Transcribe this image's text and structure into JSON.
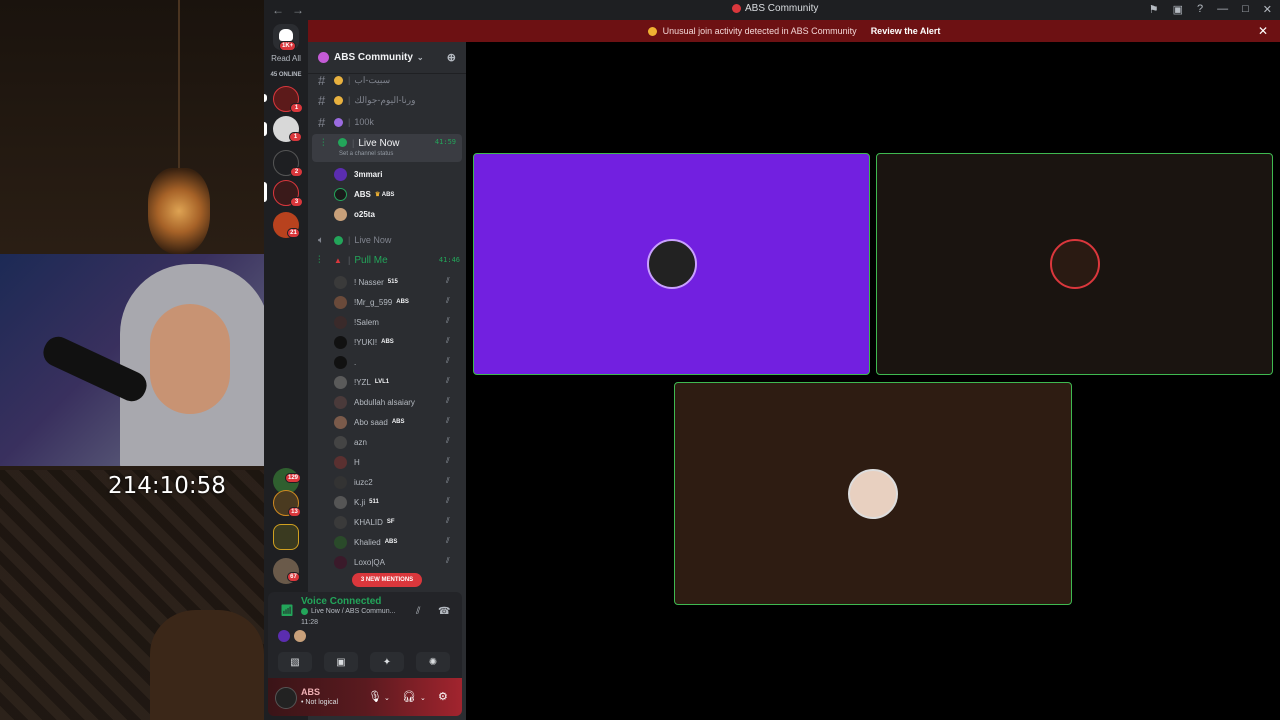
{
  "stream": {
    "timer": "214:10:58"
  },
  "window": {
    "title": "ABS Community",
    "nav_back": "←",
    "nav_forward": "→"
  },
  "alert": {
    "message": "Unusual join activity detected in ABS Community",
    "action": "Review the Alert",
    "close": "✕"
  },
  "rail": {
    "read_all": "Read All",
    "home_badge": "1K+",
    "online": "45 ONLINE",
    "badges": [
      "1",
      "1",
      "2",
      "3",
      "21",
      "129",
      "13",
      "67"
    ]
  },
  "server": {
    "name": "ABS Community"
  },
  "channels": [
    {
      "name": "سبيت-اب",
      "type": "text"
    },
    {
      "name": "ورنا-اليوم-جوالك",
      "type": "text"
    },
    {
      "name": "100k",
      "type": "text"
    }
  ],
  "live_now": {
    "name": "Live Now",
    "time": "41:59",
    "status": "Set a channel status",
    "users": [
      {
        "name": "3mmari",
        "tag": ""
      },
      {
        "name": "ABS",
        "tag": "ABS"
      },
      {
        "name": "o25ta",
        "tag": ""
      }
    ]
  },
  "live_now_2": {
    "name": "Live Now"
  },
  "pull_me": {
    "name": "Pull Me",
    "time": "41:46",
    "users": [
      {
        "name": "! Nasser",
        "tag": "515"
      },
      {
        "name": "!Mr_g_599",
        "tag": "ABS"
      },
      {
        "name": "!Salem",
        "tag": ""
      },
      {
        "name": "!YUKI!",
        "tag": "ABS"
      },
      {
        "name": ".",
        "tag": ""
      },
      {
        "name": "!YZL",
        "tag": "LVL1"
      },
      {
        "name": "Abdullah alsaiary",
        "tag": ""
      },
      {
        "name": "Abo saad",
        "tag": "ABS"
      },
      {
        "name": "azn",
        "tag": ""
      },
      {
        "name": "H",
        "tag": ""
      },
      {
        "name": "iuzc2",
        "tag": ""
      },
      {
        "name": "K.ji",
        "tag": "511"
      },
      {
        "name": "KHALID",
        "tag": "SF"
      },
      {
        "name": "Khalied",
        "tag": "ABS"
      },
      {
        "name": "Loxo|QA",
        "tag": ""
      }
    ]
  },
  "mentions": "3 NEW MENTIONS",
  "voice": {
    "title": "Voice Connected",
    "channel": "Live Now / ABS Commun...",
    "time": "11:28"
  },
  "user": {
    "name": "ABS",
    "status": "• Not logical"
  },
  "colors": {
    "accent_green": "#23a55a",
    "alert_red": "#6d1113",
    "tile1": "#7220e0",
    "tile2": "#1a1410",
    "tile3": "#2e1c12"
  }
}
